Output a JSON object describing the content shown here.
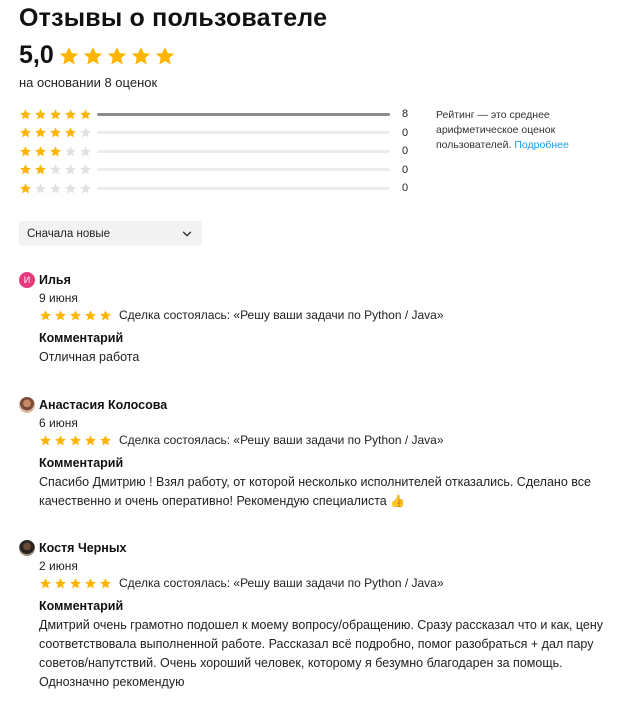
{
  "header": {
    "title": "Отзывы о пользователе",
    "score": "5,0",
    "based_on": "на основании 8 оценок"
  },
  "colors": {
    "star": "#ffb400",
    "star_empty": "#e1e1e1",
    "link": "#1a9ce8",
    "avatar_letter_bg": "#e8397d"
  },
  "distribution": [
    {
      "stars": 5,
      "count": "8",
      "fraction": 1.0
    },
    {
      "stars": 4,
      "count": "0",
      "fraction": 0
    },
    {
      "stars": 3,
      "count": "0",
      "fraction": 0
    },
    {
      "stars": 2,
      "count": "0",
      "fraction": 0
    },
    {
      "stars": 1,
      "count": "0",
      "fraction": 0
    }
  ],
  "rating_note": {
    "text": "Рейтинг — это среднее арифметическое оценок пользователей.",
    "link": "Подробнее"
  },
  "sort": {
    "label": "Сначала новые",
    "icon": "chevron-down-icon"
  },
  "reviews": [
    {
      "avatar_letter": "И",
      "name": "Илья",
      "date": "9 июня",
      "stars": 5,
      "deal": "Сделка состоялась: «Решу ваши задачи по Python / Java»",
      "comment_label": "Комментарий",
      "comment": "Отличная работа"
    },
    {
      "avatar_letter": "",
      "name": "Анастасия Колосова",
      "date": "6 июня",
      "stars": 5,
      "deal": "Сделка состоялась: «Решу ваши задачи по Python / Java»",
      "comment_label": "Комментарий",
      "comment": "Спасибо Дмитрию ! Взял работу, от которой несколько исполнителей отказались. Сделано все качественно и очень оперативно! Рекомендую специалиста",
      "emoji": "👍"
    },
    {
      "avatar_letter": "",
      "name": "Костя Черных",
      "date": "2 июня",
      "stars": 5,
      "deal": "Сделка состоялась: «Решу ваши задачи по Python / Java»",
      "comment_label": "Комментарий",
      "comment": "Дмитрий очень грамотно подошел к моему вопросу/обращению. Сразу рассказал что и как, цену соответствовала выполненной работе. Рассказал всё подробно, помог разобраться + дал пару советов/напутствий. Очень хороший человек, которому я безумно благодарен за помощь. Однозначно рекомендую"
    }
  ]
}
